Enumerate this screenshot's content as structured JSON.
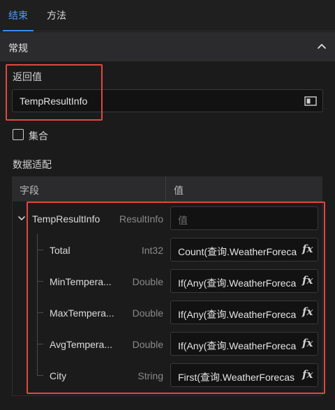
{
  "tabs": [
    {
      "label": "结束",
      "active": true
    },
    {
      "label": "方法",
      "active": false
    }
  ],
  "section": {
    "title": "常规",
    "collapse_icon": "chevron-up-icon"
  },
  "return_value": {
    "label": "返回值",
    "value": "TempResultInfo",
    "icon": "panel-icon"
  },
  "collection": {
    "label": "集合",
    "checked": false
  },
  "data_mapping": {
    "label": "数据适配"
  },
  "table": {
    "headers": {
      "field": "字段",
      "value": "值"
    },
    "root": {
      "name": "TempResultInfo",
      "type": "ResultInfo",
      "placeholder": "值",
      "expand_icon": "chevron-down-icon"
    },
    "rows": [
      {
        "name": "Total",
        "type": "Int32",
        "value": "Count(查询.WeatherForeca"
      },
      {
        "name": "MinTempera...",
        "type": "Double",
        "value": "If(Any(查询.WeatherForeca"
      },
      {
        "name": "MaxTempera...",
        "type": "Double",
        "value": "If(Any(查询.WeatherForeca"
      },
      {
        "name": "AvgTempera...",
        "type": "Double",
        "value": "If(Any(查询.WeatherForeca"
      },
      {
        "name": "City",
        "type": "String",
        "value": "First(查询.WeatherForecas"
      }
    ],
    "fx_label": "fx"
  },
  "colors": {
    "accent": "#3b8cff",
    "highlight": "#e0483f",
    "background": "#1b1b1c"
  }
}
